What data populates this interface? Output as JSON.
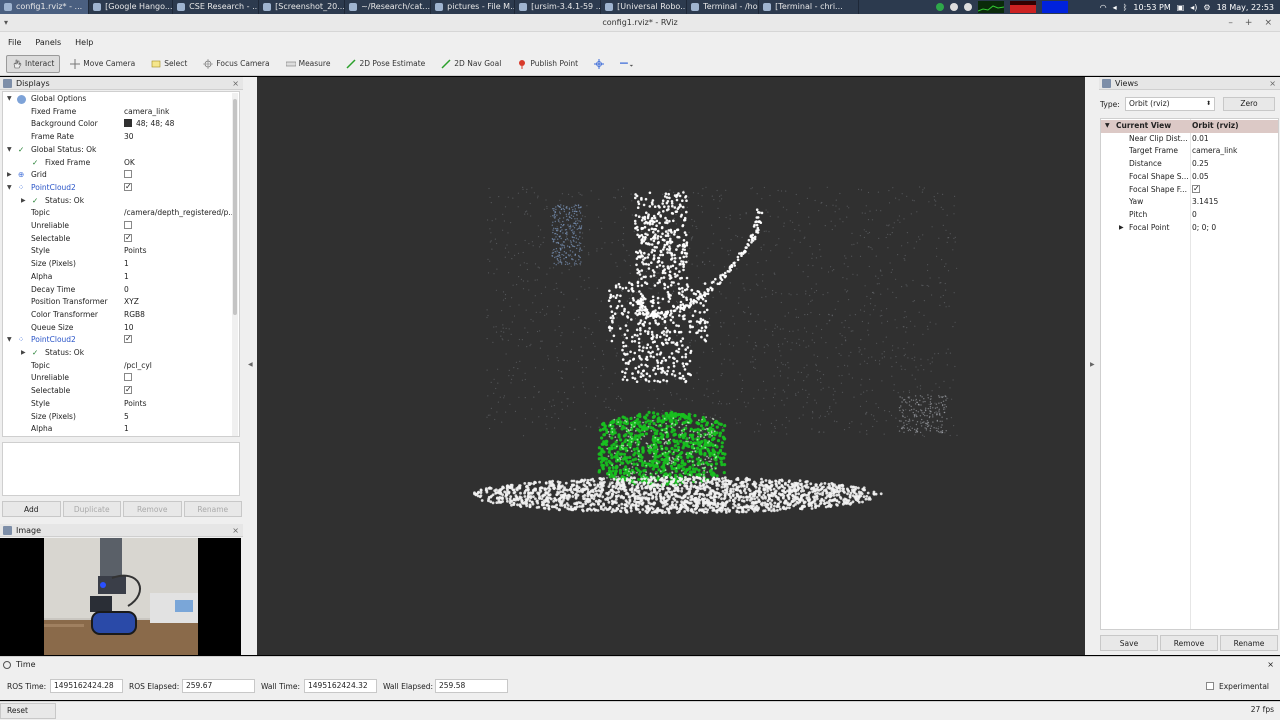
{
  "taskbar": {
    "tasks": [
      "config1.rviz* - ...",
      "[Google Hango...",
      "CSE Research - ...",
      "[Screenshot_20...",
      "~/Research/cat...",
      "pictures - File M...",
      "[ursim-3.4.1-59 ...",
      "[Universal Robo...",
      "Terminal - /ho...",
      "[Terminal - chri..."
    ],
    "clock": "10:53 PM",
    "date": "18 May, 22:53"
  },
  "window": {
    "title": "config1.rviz* - RViz",
    "minimize": "–",
    "maximize": "+",
    "close": "×",
    "menu_caret": "▾"
  },
  "menu": {
    "items": [
      "File",
      "Panels",
      "Help"
    ]
  },
  "toolbar": {
    "tools": [
      "Interact",
      "Move Camera",
      "Select",
      "Focus Camera",
      "Measure",
      "2D Pose Estimate",
      "2D Nav Goal",
      "Publish Point"
    ],
    "extra_icons": [
      "crosshair-icon",
      "dropdown-icon"
    ]
  },
  "displays": {
    "title": "Displays",
    "rows": [
      {
        "label": "Global Options",
        "value": ""
      },
      {
        "label": "Fixed Frame",
        "value": "camera_link"
      },
      {
        "label": "Background Color",
        "value": "48; 48; 48"
      },
      {
        "label": "Frame Rate",
        "value": "30"
      },
      {
        "label": "Global Status: Ok",
        "value": ""
      },
      {
        "label": "Fixed Frame",
        "value": "OK"
      },
      {
        "label": "Grid",
        "value": ""
      },
      {
        "label": "PointCloud2",
        "value": ""
      },
      {
        "label": "Status: Ok",
        "value": ""
      },
      {
        "label": "Topic",
        "value": "/camera/depth_registered/p..."
      },
      {
        "label": "Unreliable",
        "value": ""
      },
      {
        "label": "Selectable",
        "value": ""
      },
      {
        "label": "Style",
        "value": "Points"
      },
      {
        "label": "Size (Pixels)",
        "value": "1"
      },
      {
        "label": "Alpha",
        "value": "1"
      },
      {
        "label": "Decay Time",
        "value": "0"
      },
      {
        "label": "Position Transformer",
        "value": "XYZ"
      },
      {
        "label": "Color Transformer",
        "value": "RGB8"
      },
      {
        "label": "Queue Size",
        "value": "10"
      },
      {
        "label": "PointCloud2",
        "value": ""
      },
      {
        "label": "Status: Ok",
        "value": ""
      },
      {
        "label": "Topic",
        "value": "/pcl_cyl"
      },
      {
        "label": "Unreliable",
        "value": ""
      },
      {
        "label": "Selectable",
        "value": ""
      },
      {
        "label": "Style",
        "value": "Points"
      },
      {
        "label": "Size (Pixels)",
        "value": "5"
      },
      {
        "label": "Alpha",
        "value": "1"
      }
    ],
    "buttons": [
      "Add",
      "Duplicate",
      "Remove",
      "Rename"
    ]
  },
  "image_panel": {
    "title": "Image"
  },
  "views": {
    "title": "Views",
    "type_label": "Type:",
    "type_value": "Orbit (rviz)",
    "zero_button": "Zero",
    "current_view_label": "Current View",
    "current_view_value": "Orbit (rviz)",
    "rows": [
      {
        "label": "Near Clip Dist...",
        "value": "0.01"
      },
      {
        "label": "Target Frame",
        "value": "camera_link"
      },
      {
        "label": "Distance",
        "value": "0.25"
      },
      {
        "label": "Focal Shape S...",
        "value": "0.05"
      },
      {
        "label": "Focal Shape F...",
        "value": ""
      },
      {
        "label": "Yaw",
        "value": "3.1415"
      },
      {
        "label": "Pitch",
        "value": "0"
      },
      {
        "label": "Focal Point",
        "value": "0; 0; 0"
      }
    ],
    "buttons": [
      "Save",
      "Remove",
      "Rename"
    ]
  },
  "time": {
    "title": "Time",
    "ros_time_label": "ROS Time:",
    "ros_time": "1495162424.28",
    "ros_elapsed_label": "ROS Elapsed:",
    "ros_elapsed": "259.67",
    "wall_time_label": "Wall Time:",
    "wall_time": "1495162424.32",
    "wall_elapsed_label": "Wall Elapsed:",
    "wall_elapsed": "259.58",
    "experimental_label": "Experimental"
  },
  "status": {
    "reset": "Reset",
    "fps": "27 fps"
  },
  "colors": {
    "background": "#303030",
    "cylinder": "#18c020",
    "points": "#ffffff"
  }
}
